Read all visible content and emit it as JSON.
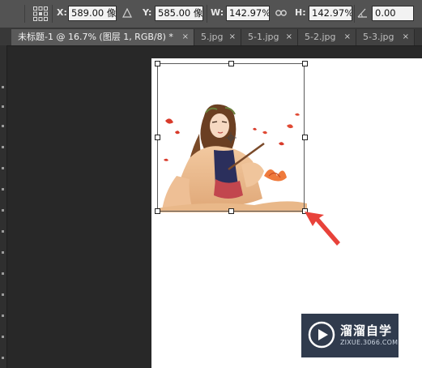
{
  "options_bar": {
    "x_label": "X:",
    "x_value": "589.00 像",
    "y_label": "Y:",
    "y_value": "585.00 像",
    "w_label": "W:",
    "w_value": "142.97%",
    "h_label": "H:",
    "h_value": "142.97%",
    "angle_value": "0.00"
  },
  "tabs": [
    {
      "label": "未标题-1 @ 16.7% (图层 1, RGB/8) *",
      "close": "×",
      "active": true
    },
    {
      "label": "5.jpg",
      "close": "×"
    },
    {
      "label": "5-1.jpg",
      "close": "×"
    },
    {
      "label": "5-2.jpg",
      "close": "×"
    },
    {
      "label": "5-3.jpg",
      "close": "×"
    }
  ],
  "watermark": {
    "title": "溜溜自学",
    "subtitle": "ZIXUE.3066.COM"
  },
  "colors": {
    "arrow": "#e8423a",
    "canvas": "#ffffff",
    "watermark_bg": "#1f2b3e"
  }
}
